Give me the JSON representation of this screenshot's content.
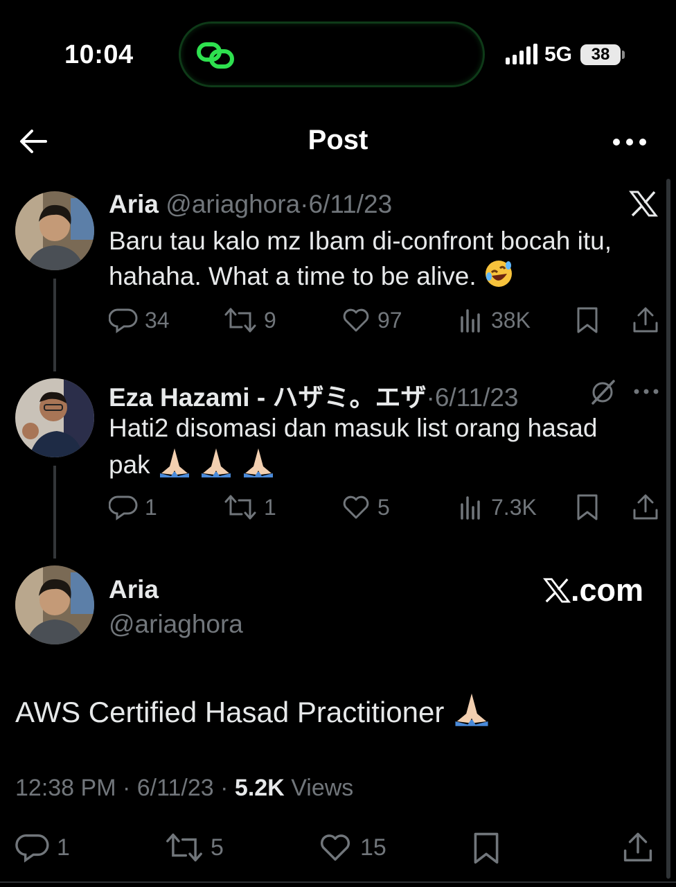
{
  "status_bar": {
    "time": "10:04",
    "network": "5G",
    "battery": "38"
  },
  "header": {
    "title": "Post"
  },
  "thread": [
    {
      "name": "Aria",
      "handle": "@ariaghora",
      "sep": "·",
      "date": "6/11/23",
      "text_line1": "Baru tau kalo mz Ibam di-confront bocah itu,",
      "text_line2": "hahaha. What a time to be alive.",
      "emoji": "rofl",
      "replies": "34",
      "reposts": "9",
      "likes": "97",
      "views": "38K"
    },
    {
      "name": "Eza Hazami - ハザミ。エザ",
      "sep": "·",
      "date": "6/11/23",
      "text_line1": "Hati2 disomasi dan masuk list orang hasad",
      "text_line2": "pak",
      "emoji": "folded-hands x3",
      "replies": "1",
      "reposts": "1",
      "likes": "5",
      "views": "7.3K"
    }
  ],
  "main_post": {
    "name": "Aria",
    "handle": "@ariaghora",
    "brand": ".com",
    "text": "AWS Certified Hasad Practitioner",
    "emoji": "folded-hands",
    "time": "12:38 PM",
    "sep": "·",
    "date": "6/11/23",
    "views_count": "5.2K",
    "views_label": "Views",
    "replies": "1",
    "reposts": "5",
    "likes": "15"
  },
  "colors": {
    "background": "#000000",
    "text": "#e7e9ea",
    "muted": "#71767b",
    "island_border": "#0e3a18",
    "island_icon": "#2ee04f"
  }
}
